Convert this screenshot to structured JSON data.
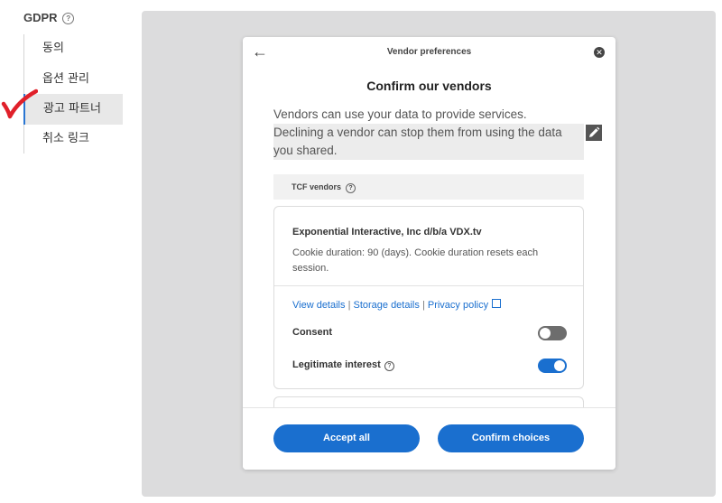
{
  "sidebar": {
    "title": "GDPR",
    "items": [
      {
        "label": "동의",
        "active": false
      },
      {
        "label": "옵션 관리",
        "active": false
      },
      {
        "label": "광고 파트너",
        "active": true
      },
      {
        "label": "취소 링크",
        "active": false
      }
    ]
  },
  "modal": {
    "header_title": "Vendor preferences",
    "title": "Confirm our vendors",
    "description_line1": "Vendors can use your data to provide services.",
    "description_line2": "Declining a vendor can stop them from using the data you shared.",
    "section_label": "TCF vendors",
    "vendor": {
      "name": "Exponential Interactive, Inc d/b/a VDX.tv",
      "duration": "Cookie duration: 90 (days). Cookie duration resets each session.",
      "links": [
        "View details",
        "Storage details",
        "Privacy policy"
      ],
      "consent_label": "Consent",
      "consent_on": false,
      "legit_label": "Legitimate interest",
      "legit_on": true
    },
    "buttons": {
      "accept_all": "Accept all",
      "confirm": "Confirm choices"
    }
  },
  "colors": {
    "accent": "#1a6fcf",
    "panel_bg": "#dcdcdd",
    "annotation_red": "#e0202a"
  }
}
